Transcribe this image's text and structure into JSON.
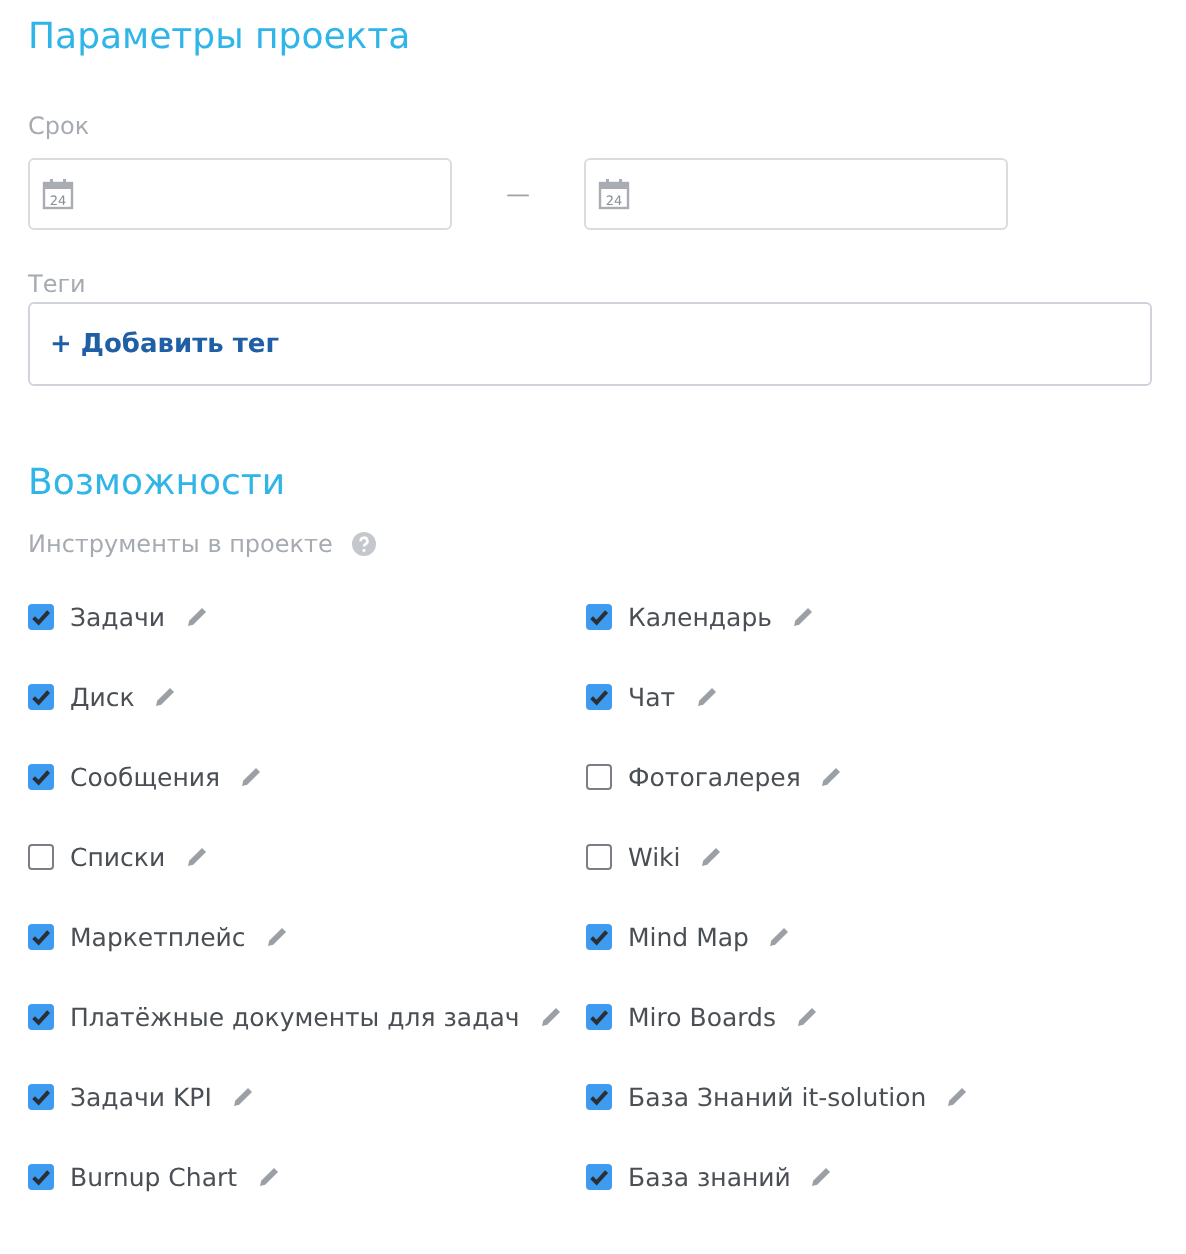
{
  "project_params": {
    "title": "Параметры проекта",
    "deadline": {
      "label": "Срок",
      "fields": [
        {
          "icon_day": "24"
        },
        {
          "icon_day": "24"
        }
      ],
      "separator": "—"
    },
    "tags": {
      "label": "Теги",
      "add_button": "+ Добавить тег"
    }
  },
  "features": {
    "title": "Возможности",
    "subtitle": "Инструменты в проекте",
    "tools": [
      {
        "label": "Задачи",
        "checked": true
      },
      {
        "label": "Календарь",
        "checked": true
      },
      {
        "label": "Диск",
        "checked": true
      },
      {
        "label": "Чат",
        "checked": true
      },
      {
        "label": "Сообщения",
        "checked": true
      },
      {
        "label": "Фотогалерея",
        "checked": false
      },
      {
        "label": "Списки",
        "checked": false
      },
      {
        "label": "Wiki",
        "checked": false
      },
      {
        "label": "Маркетплейс",
        "checked": true
      },
      {
        "label": "Mind Map",
        "checked": true
      },
      {
        "label": "Платёжные документы для задач",
        "checked": true
      },
      {
        "label": "Miro Boards",
        "checked": true
      },
      {
        "label": "Задачи KPI",
        "checked": true
      },
      {
        "label": "База Знаний it-solution",
        "checked": true
      },
      {
        "label": "Burnup Chart",
        "checked": true
      },
      {
        "label": "База знаний",
        "checked": true
      }
    ]
  }
}
